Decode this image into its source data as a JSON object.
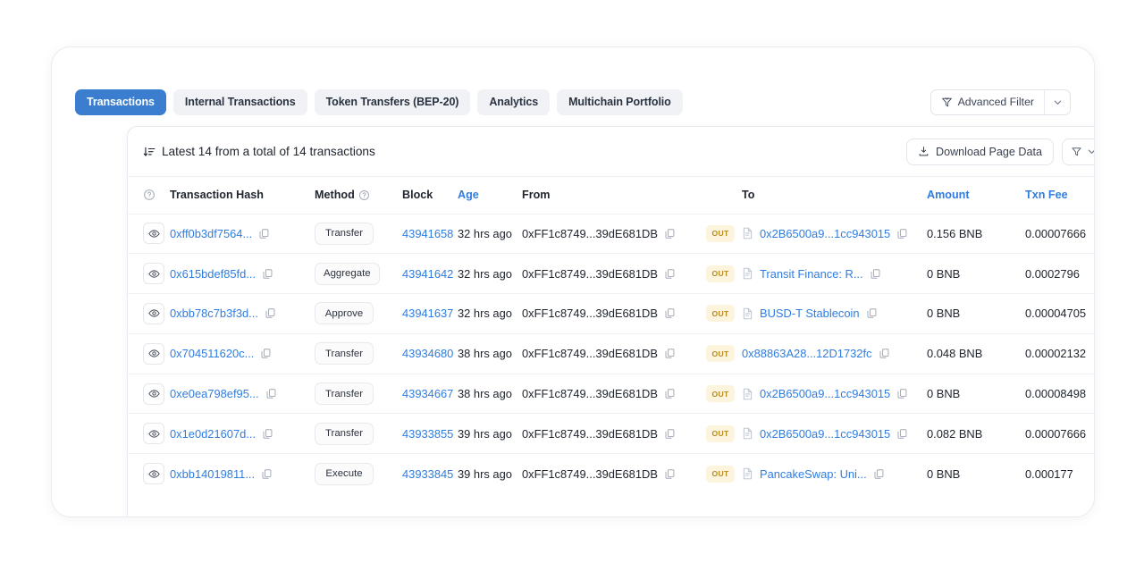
{
  "tabs": [
    {
      "label": "Transactions",
      "active": true
    },
    {
      "label": "Internal Transactions",
      "active": false
    },
    {
      "label": "Token Transfers (BEP-20)",
      "active": false
    },
    {
      "label": "Analytics",
      "active": false
    },
    {
      "label": "Multichain Portfolio",
      "active": false
    }
  ],
  "advanced_filter": {
    "label": "Advanced Filter",
    "caret": "⌄"
  },
  "card": {
    "latest_text": "Latest 14 from a total of 14 transactions",
    "download_label": "Download Page Data"
  },
  "columns": {
    "help": "?",
    "hash": "Transaction Hash",
    "method": "Method",
    "method_help": "?",
    "block": "Block",
    "age": "Age",
    "from": "From",
    "to": "To",
    "amount": "Amount",
    "fee": "Txn Fee"
  },
  "colors": {
    "accent_blue": "#3b7dce",
    "link_blue": "#2f7de1",
    "out_badge_bg": "#fdf4dd",
    "out_badge_text": "#b68a22",
    "fee_gray": "#99a0ab"
  },
  "rows": [
    {
      "hash": "0xff0b3df7564...",
      "method": "Transfer",
      "block": "43941658",
      "age": "32 hrs ago",
      "from": "0xFF1c8749...39dE681DB",
      "direction": "OUT",
      "to": "0x2B6500a9...1cc943015",
      "to_is_contract": true,
      "amount": "0.156 BNB",
      "fee": "0.00007666"
    },
    {
      "hash": "0x615bdef85fd...",
      "method": "Aggregate",
      "block": "43941642",
      "age": "32 hrs ago",
      "from": "0xFF1c8749...39dE681DB",
      "direction": "OUT",
      "to": "Transit Finance: R...",
      "to_is_contract": true,
      "amount": "0 BNB",
      "fee": "0.0002796"
    },
    {
      "hash": "0xbb78c7b3f3d...",
      "method": "Approve",
      "block": "43941637",
      "age": "32 hrs ago",
      "from": "0xFF1c8749...39dE681DB",
      "direction": "OUT",
      "to": "BUSD-T Stablecoin",
      "to_is_contract": true,
      "amount": "0 BNB",
      "fee": "0.00004705"
    },
    {
      "hash": "0x704511620c...",
      "method": "Transfer",
      "block": "43934680",
      "age": "38 hrs ago",
      "from": "0xFF1c8749...39dE681DB",
      "direction": "OUT",
      "to": "0x88863A28...12D1732fc",
      "to_is_contract": false,
      "amount": "0.048 BNB",
      "fee": "0.00002132"
    },
    {
      "hash": "0xe0ea798ef95...",
      "method": "Transfer",
      "block": "43934667",
      "age": "38 hrs ago",
      "from": "0xFF1c8749...39dE681DB",
      "direction": "OUT",
      "to": "0x2B6500a9...1cc943015",
      "to_is_contract": true,
      "amount": "0 BNB",
      "fee": "0.00008498"
    },
    {
      "hash": "0x1e0d21607d...",
      "method": "Transfer",
      "block": "43933855",
      "age": "39 hrs ago",
      "from": "0xFF1c8749...39dE681DB",
      "direction": "OUT",
      "to": "0x2B6500a9...1cc943015",
      "to_is_contract": true,
      "amount": "0.082 BNB",
      "fee": "0.00007666"
    },
    {
      "hash": "0xbb14019811...",
      "method": "Execute",
      "block": "43933845",
      "age": "39 hrs ago",
      "from": "0xFF1c8749...39dE681DB",
      "direction": "OUT",
      "to": "PancakeSwap: Uni...",
      "to_is_contract": true,
      "amount": "0 BNB",
      "fee": "0.000177"
    }
  ],
  "icons": {
    "eye": "eye-icon",
    "copy": "copy-icon",
    "document": "document-icon",
    "sort": "sort-desc-icon",
    "download": "download-icon",
    "funnel": "funnel-icon",
    "advanced_filter": "advanced-filter-icon",
    "help": "help-circle-icon"
  }
}
